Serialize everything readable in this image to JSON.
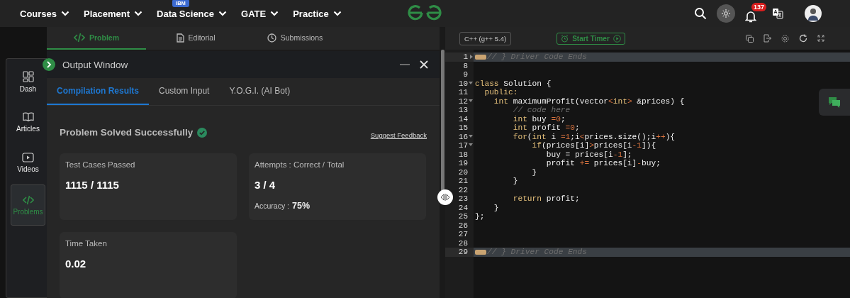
{
  "nav": {
    "items": [
      {
        "label": "Courses"
      },
      {
        "label": "Placement"
      },
      {
        "label": "Data Science",
        "badge": "IBM"
      },
      {
        "label": "GATE"
      },
      {
        "label": "Practice"
      }
    ],
    "notifications": "137"
  },
  "problem_tabs": [
    {
      "label": "Problem",
      "selected": true
    },
    {
      "label": "Editorial",
      "selected": false
    },
    {
      "label": "Submissions",
      "selected": false
    }
  ],
  "sidebar": {
    "items": [
      {
        "label": "Dash",
        "selected": false
      },
      {
        "label": "Articles",
        "selected": false
      },
      {
        "label": "Videos",
        "selected": false
      },
      {
        "label": "Problems",
        "selected": true
      }
    ]
  },
  "output_window": {
    "title": "Output Window",
    "tabs": [
      {
        "label": "Compilation Results",
        "selected": true
      },
      {
        "label": "Custom Input",
        "selected": false
      },
      {
        "label": "Y.O.G.I. (AI Bot)",
        "selected": false
      }
    ],
    "status": "Problem Solved Successfully",
    "feedback_link": "Suggest Feedback",
    "cards": [
      {
        "label": "Test Cases Passed",
        "value": "1115 / 1115"
      },
      {
        "label": "Attempts : Correct / Total",
        "value": "3 / 4",
        "extra_label": "Accuracy :",
        "extra_value": "75%"
      },
      {
        "label": "Time Taken",
        "value": "0.02"
      }
    ]
  },
  "editor": {
    "language": "C++ (g++ 5.4)",
    "timer_button": "Start Timer",
    "lines": [
      {
        "number": "1",
        "fold_open": false,
        "highlighted": true,
        "folded": true,
        "segments": [
          {
            "kind": "comment",
            "t": "// } Driver Code Ends"
          }
        ]
      },
      {
        "number": "8",
        "highlighted": false
      },
      {
        "number": "9",
        "highlighted": false
      },
      {
        "number": "10",
        "fold_open": true,
        "highlighted": false,
        "segments": [
          {
            "kind": "kw",
            "t": "class"
          },
          {
            "kind": "plain",
            "t": " Solution {"
          }
        ]
      },
      {
        "number": "11",
        "highlighted": false,
        "segments": [
          {
            "kind": "kw",
            "t": "  public:"
          }
        ]
      },
      {
        "number": "12",
        "fold_open": true,
        "highlighted": false,
        "segments": [
          {
            "kind": "kw",
            "t": "    int"
          },
          {
            "kind": "plain",
            "t": " maximumProfit(vector"
          },
          {
            "kind": "op",
            "t": "<"
          },
          {
            "kind": "kw",
            "t": "int"
          },
          {
            "kind": "op",
            "t": ">"
          },
          {
            "kind": "plain",
            "t": " &prices) {"
          }
        ]
      },
      {
        "number": "13",
        "highlighted": false,
        "segments": [
          {
            "kind": "comment",
            "t": "        // code here"
          }
        ]
      },
      {
        "number": "14",
        "highlighted": false,
        "segments": [
          {
            "kind": "kw",
            "t": "        int"
          },
          {
            "kind": "plain",
            "t": " buy "
          },
          {
            "kind": "op",
            "t": "="
          },
          {
            "kind": "num",
            "t": "0"
          },
          {
            "kind": "plain",
            "t": ";"
          }
        ]
      },
      {
        "number": "15",
        "highlighted": false,
        "segments": [
          {
            "kind": "kw",
            "t": "        int"
          },
          {
            "kind": "plain",
            "t": " profit "
          },
          {
            "kind": "op",
            "t": "="
          },
          {
            "kind": "num",
            "t": "0"
          },
          {
            "kind": "plain",
            "t": ";"
          }
        ]
      },
      {
        "number": "16",
        "fold_open": true,
        "highlighted": false,
        "segments": [
          {
            "kind": "kw",
            "t": "        for"
          },
          {
            "kind": "plain",
            "t": "("
          },
          {
            "kind": "kw",
            "t": "int"
          },
          {
            "kind": "plain",
            "t": " i "
          },
          {
            "kind": "op",
            "t": "="
          },
          {
            "kind": "num",
            "t": "1"
          },
          {
            "kind": "plain",
            "t": ";i"
          },
          {
            "kind": "op",
            "t": "<"
          },
          {
            "kind": "plain",
            "t": "prices.size();i"
          },
          {
            "kind": "op",
            "t": "++"
          },
          {
            "kind": "plain",
            "t": "){"
          }
        ]
      },
      {
        "number": "17",
        "fold_open": true,
        "highlighted": false,
        "segments": [
          {
            "kind": "kw",
            "t": "            if"
          },
          {
            "kind": "plain",
            "t": "(prices[i]"
          },
          {
            "kind": "op",
            "t": ">"
          },
          {
            "kind": "plain",
            "t": "prices[i"
          },
          {
            "kind": "op",
            "t": "-"
          },
          {
            "kind": "num",
            "t": "1"
          },
          {
            "kind": "plain",
            "t": "]){"
          }
        ]
      },
      {
        "number": "18",
        "highlighted": false,
        "segments": [
          {
            "kind": "plain",
            "t": "               buy = prices[i"
          },
          {
            "kind": "op",
            "t": "-"
          },
          {
            "kind": "num",
            "t": "1"
          },
          {
            "kind": "plain",
            "t": "];"
          }
        ]
      },
      {
        "number": "19",
        "highlighted": false,
        "segments": [
          {
            "kind": "plain",
            "t": "               profit "
          },
          {
            "kind": "op",
            "t": "+="
          },
          {
            "kind": "plain",
            "t": " prices[i]"
          },
          {
            "kind": "op",
            "t": "-"
          },
          {
            "kind": "plain",
            "t": "buy;"
          }
        ]
      },
      {
        "number": "20",
        "highlighted": false,
        "segments": [
          {
            "kind": "plain",
            "t": "            }"
          }
        ]
      },
      {
        "number": "21",
        "highlighted": false,
        "segments": [
          {
            "kind": "plain",
            "t": "        }"
          }
        ]
      },
      {
        "number": "22",
        "highlighted": false
      },
      {
        "number": "23",
        "highlighted": false,
        "segments": [
          {
            "kind": "kw",
            "t": "        return"
          },
          {
            "kind": "plain",
            "t": " profit;"
          }
        ]
      },
      {
        "number": "24",
        "highlighted": false,
        "segments": [
          {
            "kind": "plain",
            "t": "    }"
          }
        ]
      },
      {
        "number": "25",
        "highlighted": false,
        "segments": [
          {
            "kind": "plain",
            "t": "};"
          }
        ]
      },
      {
        "number": "26",
        "highlighted": false
      },
      {
        "number": "27",
        "highlighted": false
      },
      {
        "number": "28",
        "highlighted": false
      },
      {
        "number": "29",
        "highlighted": true,
        "folded": true,
        "segments": [
          {
            "kind": "comment",
            "t": "// } Driver Code Ends"
          }
        ]
      }
    ]
  }
}
